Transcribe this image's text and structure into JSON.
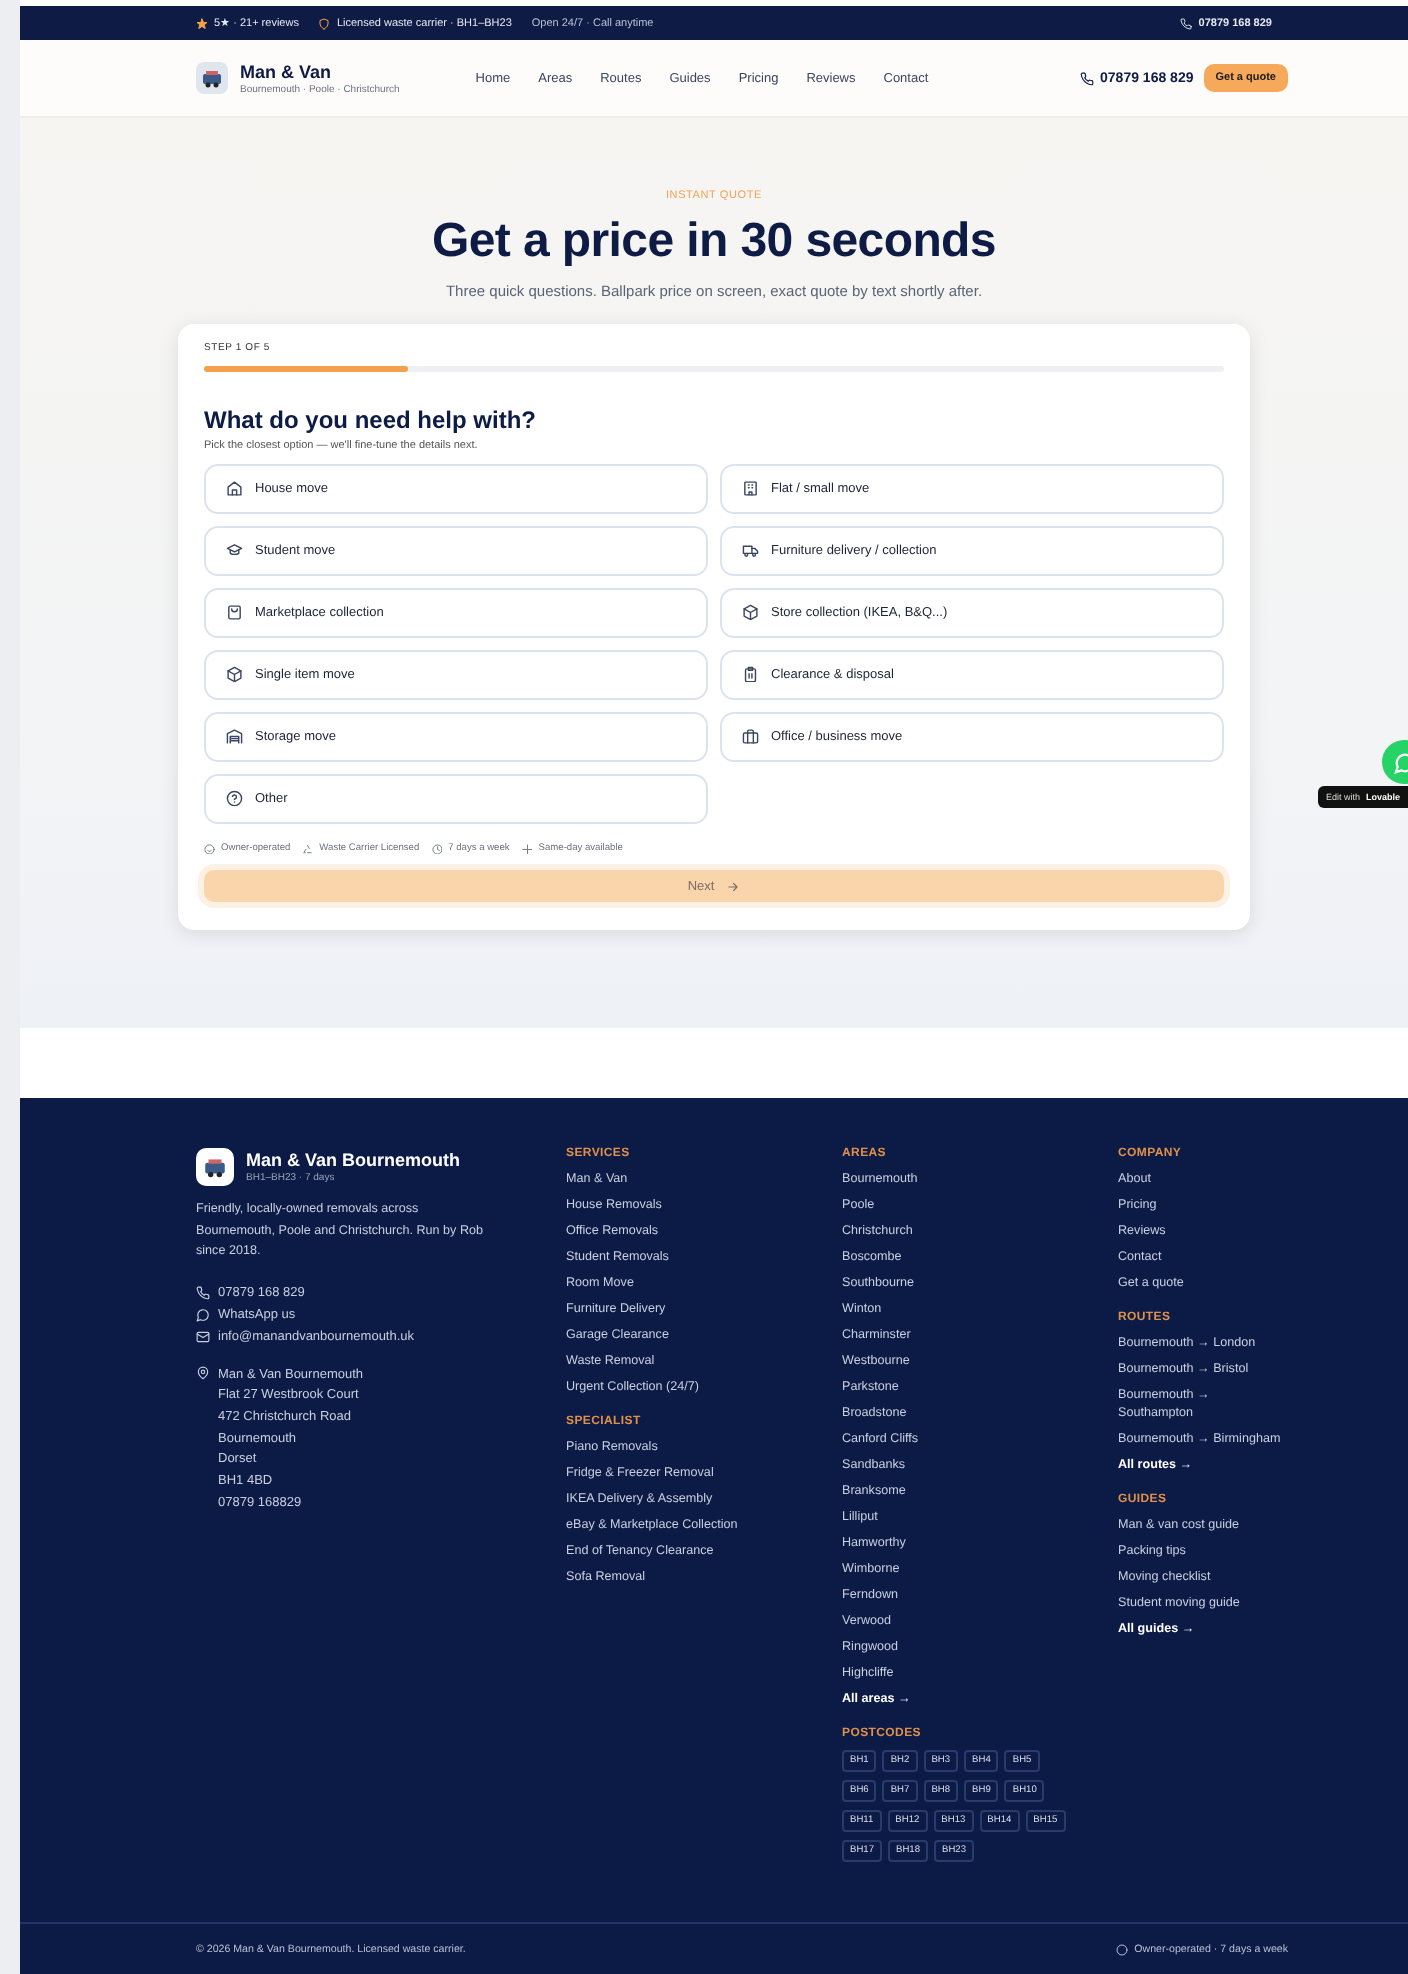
{
  "top_bar": {
    "rating": "5★ · 21+ reviews",
    "license": "Licensed waste carrier · BH1–BH23",
    "hours": "Open 24/7 · Call anytime",
    "phone": "07879 168 829"
  },
  "header": {
    "brand": "Man & Van",
    "tagline": "Bournemouth · Poole · Christchurch",
    "nav": [
      "Home",
      "Areas",
      "Routes",
      "Guides",
      "Pricing",
      "Reviews",
      "Contact"
    ],
    "phone": "07879 168 829",
    "cta": "Get a quote"
  },
  "hero": {
    "eyebrow": "INSTANT QUOTE",
    "title": "Get a price in 30 seconds",
    "subtitle": "Three quick questions. Ballpark price on screen, exact quote by text shortly after."
  },
  "quote_form": {
    "step": "STEP 1 OF 5",
    "progress": {
      "level": 0.2
    },
    "question": "What do you need help with?",
    "hint": "Pick the closest option — we'll fine-tune the details next.",
    "options": [
      {
        "label": "House move",
        "selected": false
      },
      {
        "label": "Flat / small move",
        "selected": false
      },
      {
        "label": "Student move",
        "selected": false
      },
      {
        "label": "Furniture delivery / collection",
        "selected": false
      },
      {
        "label": "Marketplace collection",
        "selected": false
      },
      {
        "label": "Store collection (IKEA, B&Q...)",
        "selected": false
      },
      {
        "label": "Single item move",
        "selected": false
      },
      {
        "label": "Clearance & disposal",
        "selected": false
      },
      {
        "label": "Storage move",
        "selected": false
      },
      {
        "label": "Office / business move",
        "selected": false
      },
      {
        "label": "Other",
        "selected": false
      }
    ],
    "badges": [
      "Owner-operated",
      "Waste Carrier Licensed",
      "7 days a week",
      "Same-day available"
    ],
    "next": {
      "label": "Next",
      "disabled": true
    }
  },
  "edit_badge": {
    "prefix": "Edit with",
    "brand": "Lovable"
  },
  "footer": {
    "brand": "Man & Van Bournemouth",
    "brand_sub": "BH1–BH23 · 7 days",
    "about": "Friendly, locally-owned removals across Bournemouth, Poole and Christchurch. Run by Rob since 2018.",
    "contacts": [
      "07879 168 829",
      "WhatsApp us",
      "info@manandvanbournemouth.uk"
    ],
    "address": [
      "Man & Van Bournemouth",
      "Flat 27 Westbrook Court",
      "472 Christchurch Road",
      "Bournemouth",
      "Dorset",
      "BH1 4BD",
      "07879 168829"
    ],
    "columns": [
      {
        "sections": [
          {
            "title": "SERVICES",
            "links": [
              "Man & Van",
              "House Removals",
              "Office Removals",
              "Student Removals",
              "Room Move",
              "Furniture Delivery",
              "Garage Clearance",
              "Waste Removal",
              "Urgent Collection (24/7)"
            ]
          },
          {
            "title": "SPECIALIST",
            "links": [
              "Piano Removals",
              "Fridge & Freezer Removal",
              "IKEA Delivery & Assembly",
              "eBay & Marketplace Collection",
              "End of Tenancy Clearance",
              "Sofa Removal"
            ]
          }
        ]
      },
      {
        "sections": [
          {
            "title": "AREAS",
            "links": [
              "Bournemouth",
              "Poole",
              "Christchurch",
              "Boscombe",
              "Southbourne",
              "Winton",
              "Charminster",
              "Westbourne",
              "Parkstone",
              "Broadstone",
              "Canford Cliffs",
              "Sandbanks",
              "Branksome",
              "Lilliput",
              "Hamworthy",
              "Wimborne",
              "Ferndown",
              "Verwood",
              "Ringwood",
              "Highcliffe"
            ],
            "more": "All areas →"
          },
          {
            "title": "POSTCODES",
            "tags": [
              "BH1",
              "BH2",
              "BH3",
              "BH4",
              "BH5",
              "BH6",
              "BH7",
              "BH8",
              "BH9",
              "BH10",
              "BH11",
              "BH12",
              "BH13",
              "BH14",
              "BH15",
              "BH17",
              "BH18",
              "BH23"
            ]
          }
        ]
      },
      {
        "sections": [
          {
            "title": "COMPANY",
            "links": [
              "About",
              "Pricing",
              "Reviews",
              "Contact",
              "Get a quote"
            ]
          },
          {
            "title": "ROUTES",
            "links": [
              "Bournemouth → London",
              "Bournemouth → Bristol",
              "Bournemouth → Southampton",
              "Bournemouth → Birmingham"
            ],
            "more": "All routes →"
          },
          {
            "title": "GUIDES",
            "links": [
              "Man & van cost guide",
              "Packing tips",
              "Moving checklist",
              "Student moving guide"
            ],
            "more": "All guides →"
          }
        ]
      }
    ],
    "copyright": "© 2026 Man & Van Bournemouth. Licensed waste carrier.",
    "bottom_note": "Owner-operated · 7 days a week"
  }
}
